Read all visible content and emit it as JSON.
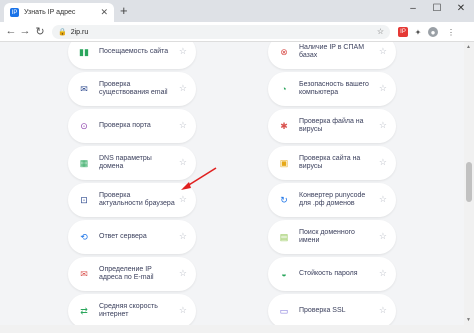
{
  "browser": {
    "tab_title": "Узнать IP адрес",
    "url": "2ip.ru"
  },
  "services_left": [
    {
      "label": "Посещаемость сайта",
      "icon": "chart-icon",
      "color": "#2aa65c"
    },
    {
      "label": "Проверка существования email",
      "icon": "envelope-check-icon",
      "color": "#2f4b8f"
    },
    {
      "label": "Проверка порта",
      "icon": "port-icon",
      "color": "#8e44ad"
    },
    {
      "label": "DNS параметры домена",
      "icon": "dns-icon",
      "color": "#2aa65c"
    },
    {
      "label": "Проверка актуальности браузера",
      "icon": "browser-check-icon",
      "color": "#2f4b8f"
    },
    {
      "label": "Ответ сервера",
      "icon": "server-icon",
      "color": "#1a73e8"
    },
    {
      "label": "Определение IP адреса по E-mail",
      "icon": "email-ip-icon",
      "color": "#d9534f"
    },
    {
      "label": "Средняя скорость интернет",
      "icon": "speed-icon",
      "color": "#2aa65c"
    }
  ],
  "services_right": [
    {
      "label": "Наличие IP в СПАМ базах",
      "icon": "spam-block-icon",
      "color": "#d9534f"
    },
    {
      "label": "Безопасность вашего компьютера",
      "icon": "security-icon",
      "color": "#2aa65c"
    },
    {
      "label": "Проверка файла на вирусы",
      "icon": "bug-icon",
      "color": "#d9534f"
    },
    {
      "label": "Проверка сайта на вирусы",
      "icon": "site-virus-icon",
      "color": "#e6a817"
    },
    {
      "label": "Конвертер punycode для .рф доменов",
      "icon": "punycode-icon",
      "color": "#1a73e8"
    },
    {
      "label": "Поиск доменного имени",
      "icon": "domain-search-icon",
      "color": "#8bc34a"
    },
    {
      "label": "Стойкость пароля",
      "icon": "password-icon",
      "color": "#2aa65c"
    },
    {
      "label": "Проверка SSL",
      "icon": "ssl-icon",
      "color": "#7a6fd8"
    }
  ]
}
